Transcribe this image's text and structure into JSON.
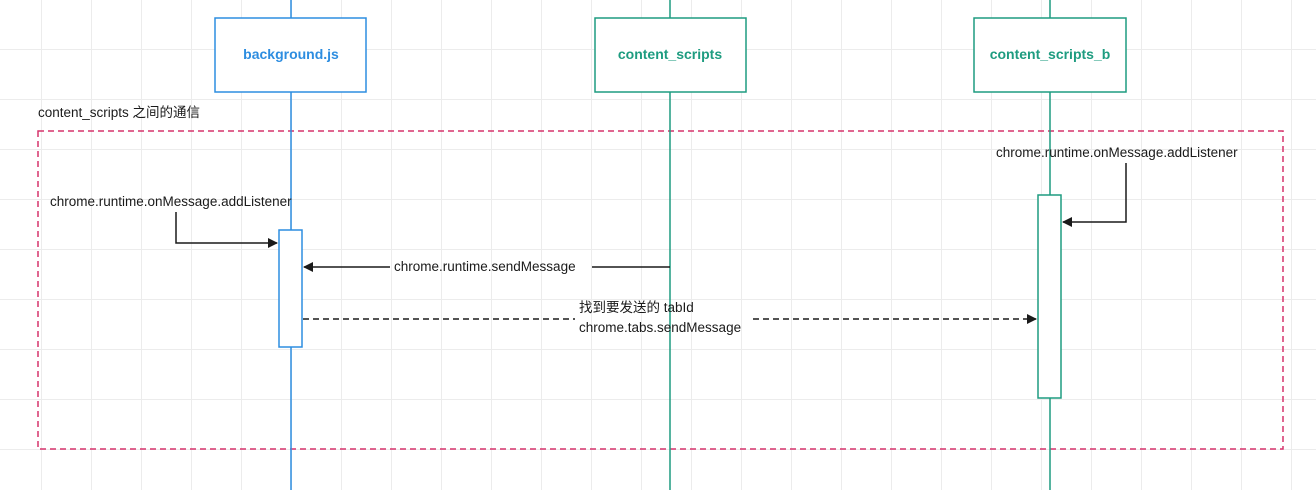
{
  "diagram": {
    "group_frame": {
      "label": "content_scripts 之间的通信",
      "border_color": "#d6336c"
    },
    "participants": [
      {
        "id": "background",
        "label": "background.js",
        "color": "#2d8de0"
      },
      {
        "id": "content",
        "label": "content_scripts",
        "color": "#1e9c80"
      },
      {
        "id": "content_b",
        "label": "content_scripts_b",
        "color": "#1e9c80"
      }
    ],
    "notes": {
      "background_listener": "chrome.runtime.onMessage.addListener",
      "content_b_listener": "chrome.runtime.onMessage.addListener"
    },
    "messages": {
      "runtime_send": "chrome.runtime.sendMessage",
      "tabs_send_line1": "找到要发送的 tabId",
      "tabs_send_line2": "chrome.tabs.sendMessage"
    }
  }
}
